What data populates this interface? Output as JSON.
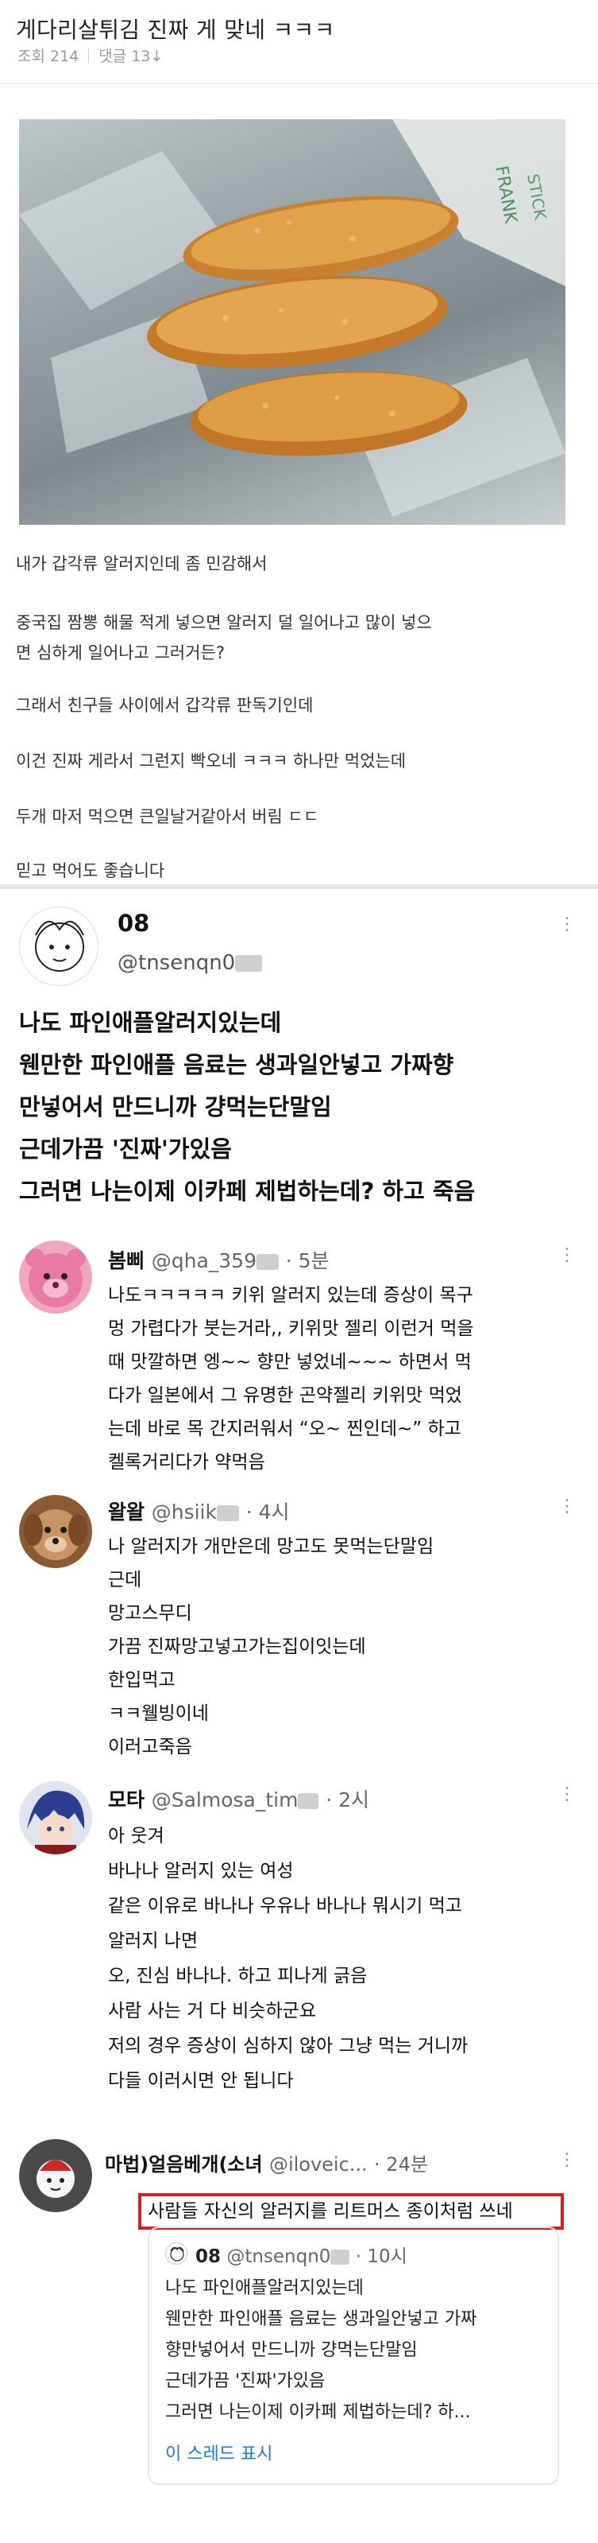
{
  "post": {
    "title": "게다리살튀김 진짜 게 맞네 ㅋㅋㅋ",
    "views": "조회 214",
    "comments": "댓글 13↓",
    "paragraphs": [
      "내가 갑각류 알러지인데 좀 민감해서",
      "중국집 짬뽕 해물 적게 넣으면 알러지 덜 일어나고 많이 넣으",
      "면 심하게 일어나고 그러거든?",
      "그래서 친구들 사이에서 갑각류 판독기인데",
      "이건 진짜 게라서 그런지 빡오네 ㅋㅋㅋ 하나만 먹었는데",
      "두개 마저 먹으면 큰일날거같아서 버림 ㄷㄷ",
      "믿고 먹어도 좋습니다"
    ]
  },
  "tweet": {
    "name": "08",
    "handle": "@tnsenqn0",
    "more": "⋮",
    "lines": [
      "나도 파인애플알러지있는데",
      "웬만한 파인애플 음료는 생과일안넣고 가짜향",
      "만넣어서 만드니까 걍먹는단말임",
      "근데가끔 '진짜'가있음",
      "그러면 나는이제 이카페 제법하는데? 하고 죽음"
    ]
  },
  "replies": [
    {
      "name": "봄삐",
      "handle": "@qha_359",
      "time": "· 5분",
      "lines": [
        "나도ㅋㅋㅋㅋㅋ 키위 알러지 있는데 증상이 목구",
        "멍 가렵다가 붓는거라,, 키위맛 젤리 이런거 먹을",
        "때 맛깔하면 엥~~ 향만 넣었네~~~ 하면서 먹",
        "다가 일본에서 그 유명한 곤약젤리 키위맛 먹었",
        "는데 바로 목 간지러워서 “오~ 찐인데~” 하고",
        "켈록거리다가 약먹음"
      ]
    },
    {
      "name": "왈왈",
      "handle": "@hsiik",
      "time": "· 4시",
      "lines": [
        "나 알러지가 개만은데 망고도 못먹는단말임",
        "근데",
        "망고스무디",
        "가끔 진짜망고넣고가는집이잇는데",
        "한입먹고",
        "ㅋㅋ웰빙이네",
        "이러고죽음"
      ]
    },
    {
      "name": "모타",
      "handle": "@Salmosa_tim",
      "time": "· 2시",
      "lines": [
        "아 웃겨",
        "바나나 알러지 있는 여성",
        "같은 이유로 바나나 우유나 바나나 뭐시기 먹고",
        "알러지 나면",
        "오, 진심 바나나. 하고 피나게 긁음",
        "사람 사는 거 다 비슷하군요",
        "저의 경우 증상이 심하지 않아 그냥 먹는 거니까",
        "다들 이러시면 안 됩니다"
      ]
    },
    {
      "name": "마법)얼음베개(소녀",
      "handle": "@iloveic...",
      "time": "· 24분",
      "lines": [
        "사람들 자신의 알러지를 리트머스 종이처럼 쓰네"
      ]
    }
  ],
  "quote": {
    "name": "08",
    "handle": "@tnsenqn0",
    "time": "· 10시",
    "lines": [
      "나도 파인애플알러지있는데",
      "웬만한 파인애플 음료는 생과일안넣고 가짜",
      "향만넣어서 만드니까 걍먹는단말임",
      "근데가끔 '진짜'가있음",
      "그러면 나는이제 이카페 제법하는데? 하..."
    ],
    "thread_link": "이 스레드 표시"
  },
  "colors": {
    "highlight_border": "#d42020",
    "link": "#1d78d6"
  }
}
